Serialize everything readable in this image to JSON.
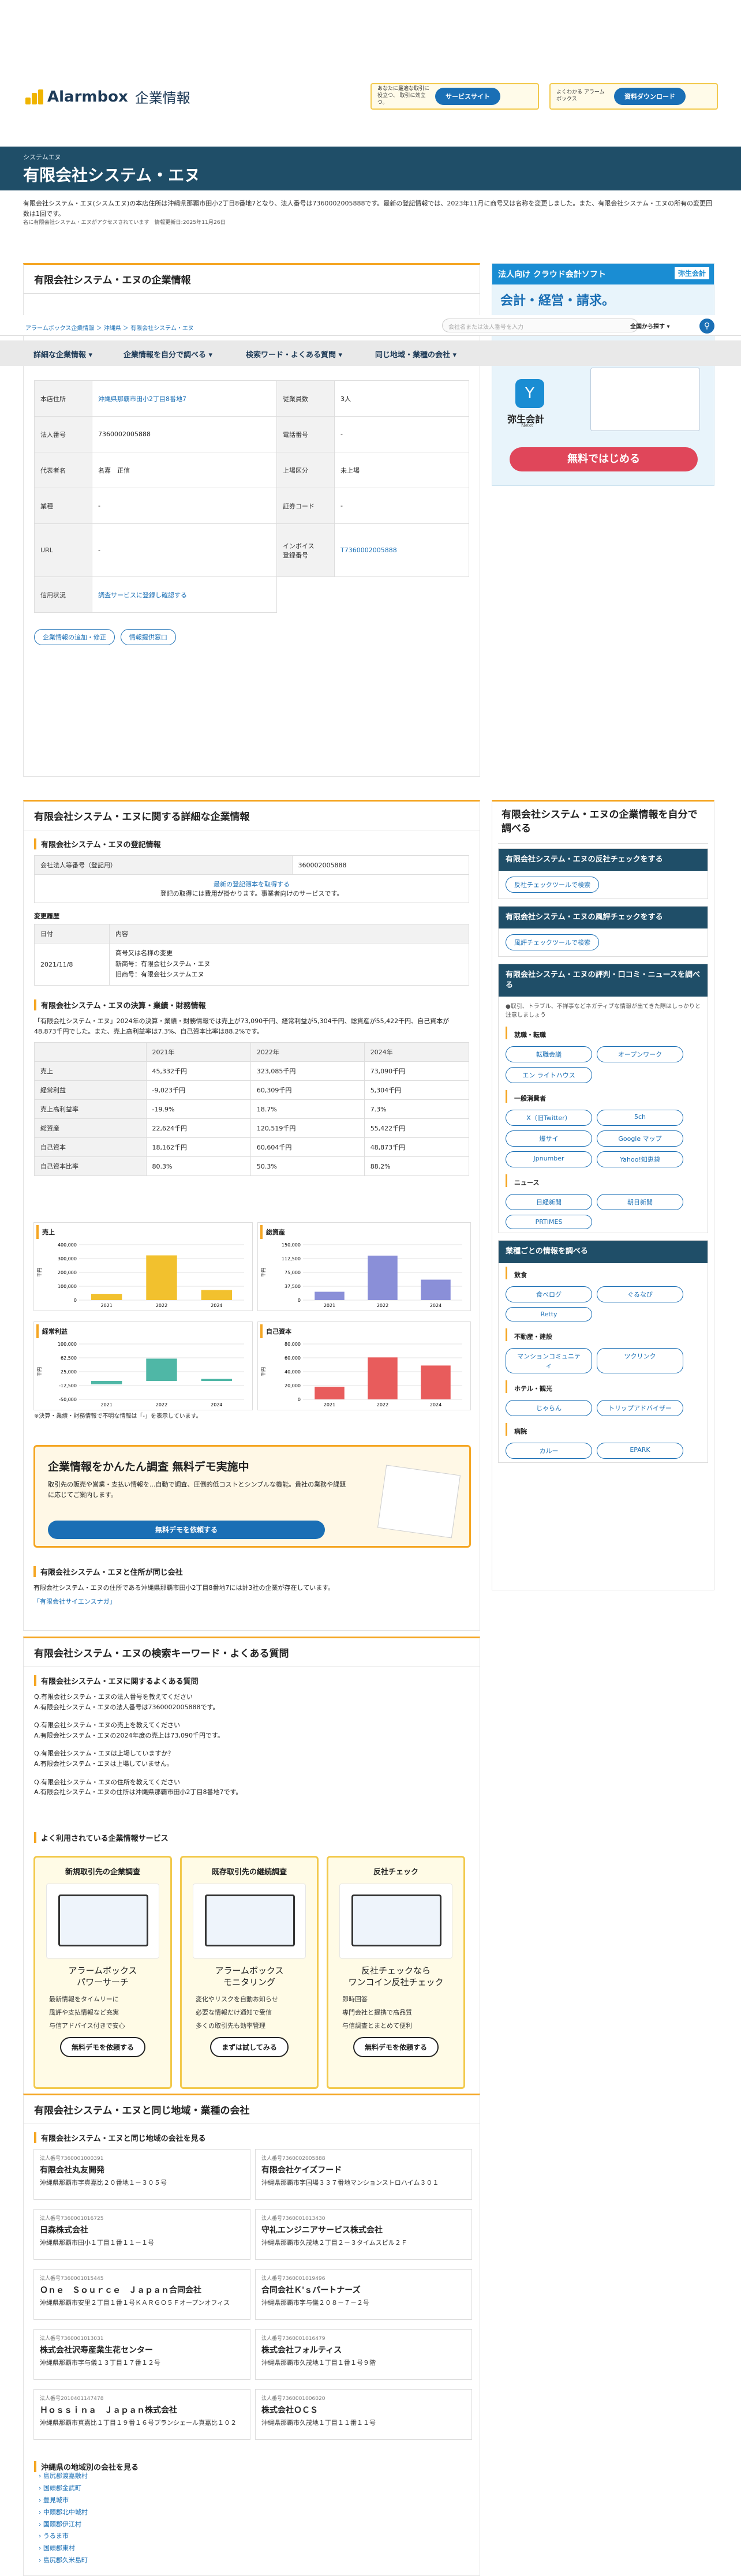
{
  "header": {
    "logo_text": "Alarmbox",
    "logo_sub": "企業情報",
    "promo1_text": "あなたに最適な取引に役立つ、\n取引に効立つ。",
    "promo1_btn": "サービスサイト",
    "promo2_text": "よくわかる\nアラームボックス",
    "promo2_btn": "資料ダウンロード"
  },
  "hero": {
    "kana": "システムエヌ",
    "title": "有限会社システム・エヌ"
  },
  "intro": {
    "text": "有限会社システム・エヌ(シスムエヌ)の本店住所は沖縄県那覇市田小2丁目8番地7となり、法人番号は7360002005888です。最新の登記情報では、2023年11月に商号又は名称を変更しました。また、有限会社システム・エヌの所有の変更回数は1回です。",
    "note": "名に有限会社システム・エヌがアクセスされています",
    "updated": "情報更新日:2025年11月26日"
  },
  "overlay": {
    "breadcrumb": "アラームボックス企業情報 ＞ 沖縄県 ＞ 有限会社システム・エヌ",
    "search_placeholder": "会社名または法人番号を入力",
    "scope": "全国から探す",
    "search_icon": "search-icon"
  },
  "nav": [
    "詳細な企業情報",
    "企業情報を自分で調べる",
    "検索ワード・よくある質問",
    "同じ地域・業種の会社"
  ],
  "company_card": {
    "title": "有限会社システム・エヌの企業情報",
    "rows": [
      {
        "k1": "本店住所",
        "v1": "沖縄県那覇市田小2丁目8番地7",
        "k2": "従業員数",
        "v2": "3人"
      },
      {
        "k1": "法人番号",
        "v1": "7360002005888",
        "k2": "電話番号",
        "v2": "-"
      },
      {
        "k1": "代表者名",
        "v1": "名嘉　正信",
        "k2": "上場区分",
        "v2": "未上場"
      },
      {
        "k1": "業種",
        "v1": "-",
        "k2": "証券コード",
        "v2": "-"
      },
      {
        "k1": "URL",
        "v1": "-",
        "k2": "インボイス\n登録番号",
        "v2": "T7360002005888"
      },
      {
        "k1": "信用状況",
        "v1": "調査サービスに登録し確認する",
        "k2": "",
        "v2": ""
      }
    ],
    "btn1": "企業情報の追加・修正",
    "btn2": "情報提供窓口"
  },
  "ad": {
    "label": "法人向け クラウド会計ソフト",
    "brand": "弥生会計",
    "headline": "会計・経営・請求。",
    "product": "弥生会計",
    "product_sub": "Next",
    "cta": "無料ではじめる"
  },
  "detail": {
    "title": "有限会社システム・エヌに関する詳細な企業情報",
    "reg_title": "有限会社システム・エヌの登記情報",
    "reg_number_label": "会社法人等番号（登記用）",
    "reg_number": "360002005888",
    "reg_link": "最新の登記簿本を取得する",
    "reg_note": "登記の取得には費用が掛かります。事業者向けのサービスです。",
    "history_label": "変更履歴",
    "h_date": "日付",
    "h_content": "内容",
    "h_row_date": "2021/11/8",
    "h_row_content": "商号又は名称の変更\n新商号：有限会社システム・エヌ\n旧商号：有限会社システムエヌ",
    "fin_title": "有限会社システム・エヌの決算・業績・財務情報",
    "fin_text": "「有限会社システム・エヌ」2024年の決算・業績・財務情報では売上が73,090千円、経常利益が5,304千円、総資産が55,422千円、自己資本が48,873千円でした。また、売上高利益率は7.3%、自己資本比率は88.2%です。",
    "fin_head": [
      "",
      "2021年",
      "2022年",
      "2024年"
    ],
    "fin_rows": [
      [
        "売上",
        "45,332千円",
        "323,085千円",
        "73,090千円"
      ],
      [
        "経常利益",
        "-9,023千円",
        "60,309千円",
        "5,304千円"
      ],
      [
        "売上高利益率",
        "-19.9%",
        "18.7%",
        "7.3%"
      ],
      [
        "総資産",
        "22,624千円",
        "120,519千円",
        "55,422千円"
      ],
      [
        "自己資本",
        "18,162千円",
        "60,604千円",
        "48,873千円"
      ],
      [
        "自己資本比率",
        "80.3%",
        "50.3%",
        "88.2%"
      ]
    ],
    "fin_note": "※決算・業績・財務情報で不明な情報は「-」を表示しています。"
  },
  "chart_data": [
    {
      "type": "bar",
      "title": "売上",
      "categories": [
        "2021",
        "2022",
        "2024"
      ],
      "values": [
        45332,
        323085,
        73090
      ],
      "ylim": [
        0,
        400000
      ],
      "ylabel": "千円",
      "color": "#f2c12e"
    },
    {
      "type": "bar",
      "title": "総資産",
      "categories": [
        "2021",
        "2022",
        "2024"
      ],
      "values": [
        22624,
        120519,
        55422
      ],
      "ylim": [
        0,
        150000
      ],
      "ylabel": "千円",
      "color": "#8a8fd8"
    },
    {
      "type": "bar",
      "title": "経常利益",
      "categories": [
        "2021",
        "2022",
        "2024"
      ],
      "values": [
        -9023,
        60309,
        5304
      ],
      "ylim": [
        -50000,
        100000
      ],
      "ylabel": "千円",
      "color": "#4fb7a6"
    },
    {
      "type": "bar",
      "title": "自己資本",
      "categories": [
        "2021",
        "2022",
        "2024"
      ],
      "values": [
        18162,
        60604,
        48873
      ],
      "ylim": [
        0,
        80000
      ],
      "ylabel": "千円",
      "color": "#e85c5c"
    }
  ],
  "demo": {
    "title": "企業情報をかんたん調査 無料デモ実施中",
    "text": "取引先の販売や営業・支払い情報を...自動で調査、圧倒的低コストとシンプルな機能。貴社の業務や課題に応じてご案内します。",
    "btn": "無料デモを依頼する"
  },
  "same_address": {
    "title": "有限会社システム・エヌと住所が同じ会社",
    "text": "有限会社システム・エヌの住所である沖縄県那覇市田小2丁目8番地7には計3社の企業が存在しています。",
    "link": "「有限会社サイエンスナガ」"
  },
  "side": {
    "title": "有限会社システム・エヌの企業情報を自分で調べる",
    "b1": "有限会社システム・エヌの反社チェックをする",
    "b1btn": "反社チェックツールで検索",
    "b2": "有限会社システム・エヌの風評チェックをする",
    "b2btn": "風評チェックツールで検索",
    "b3": "有限会社システム・エヌの評判・口コミ・ニュースを調べる",
    "b3note": "●取引、トラブル、不祥事などネガティブな情報が出てきた際はしっかりと注意しましょう",
    "cat1": "就職・転職",
    "cat1_items": [
      "転職会議",
      "オープンワーク",
      "エン ライトハウス"
    ],
    "cat2": "一般消費者",
    "cat2_items": [
      "X（旧Twitter）",
      "5ch",
      "爆サイ",
      "Google マップ",
      "Jpnumber",
      "Yahoo!知恵袋"
    ],
    "cat3": "ニュース",
    "cat3_items": [
      "日経新聞",
      "朝日新聞",
      "PRTIMES"
    ],
    "b4": "業種ごとの情報を調べる",
    "cat4": "飲食",
    "cat4_items": [
      "食べログ",
      "ぐるなび",
      "Retty"
    ],
    "cat5": "不動産・建設",
    "cat5_items": [
      "マンションコミュニティ",
      "ツクリンク"
    ],
    "cat6": "ホテル・観光",
    "cat6_items": [
      "じゃらん",
      "トリップアドバイザー"
    ],
    "cat7": "病院",
    "cat7_items": [
      "カルー",
      "EPARK"
    ]
  },
  "faq": {
    "title": "有限会社システム・エヌの検索キーワード・よくある質問",
    "sub": "有限会社システム・エヌに関するよくある質問",
    "items": [
      {
        "q": "Q.有限会社システム・エヌの法人番号を教えてください",
        "a": "A.有限会社システム・エヌの法人番号は7360002005888です。"
      },
      {
        "q": "Q.有限会社システム・エヌの売上を教えてください",
        "a": "A.有限会社システム・エヌの2024年度の売上は73,090千円です。"
      },
      {
        "q": "Q.有限会社システム・エヌは上場していますか？",
        "a": "A.有限会社システム・エヌは上場していません。"
      },
      {
        "q": "Q.有限会社システム・エヌの住所を教えてください",
        "a": "A.有限会社システム・エヌの住所は沖縄県那覇市田小2丁目8番地7です。"
      }
    ],
    "svc_title": "よく利用されている企業情報サービス",
    "svcs": [
      {
        "h": "新規取引先の企業調査",
        "n": "アラームボックス\nパワーサーチ",
        "l": [
          "最新情報をタイムリーに",
          "風評や支払情報など充実",
          "与信アドバイス付きで安心"
        ],
        "b": "無料デモを依頼する"
      },
      {
        "h": "既存取引先の継続調査",
        "n": "アラームボックス\nモニタリング",
        "l": [
          "変化やリスクを自動お知らせ",
          "必要な情報だけ通知で受信",
          "多くの取引先も効率管理"
        ],
        "b": "まずは試してみる"
      },
      {
        "h": "反社チェック",
        "n": "反社チェックなら\nワンコイン反社チェック",
        "l": [
          "即時回答",
          "専門会社と提携で高品質",
          "与信調査とまとめて便利"
        ],
        "b": "無料デモを依頼する"
      }
    ]
  },
  "region": {
    "title": "有限会社システム・エヌと同じ地域・業種の会社",
    "sub": "有限会社システム・エヌと同じ地域の会社を見る",
    "companies": [
      {
        "num": "法人番号7360001000391",
        "name": "有限会社丸友開発",
        "addr": "沖縄県那覇市字真嘉比２０番地１－３０５号"
      },
      {
        "num": "法人番号7360002005888",
        "name": "有限会社ケイズフード",
        "addr": "沖縄県那覇市字国場３３７番地マンションストロハイム３０１"
      },
      {
        "num": "法人番号7360001016725",
        "name": "日森株式会社",
        "addr": "沖縄県那覇市田小１丁目１番１１－１号"
      },
      {
        "num": "法人番号7360001013430",
        "name": "守礼エンジニアサービス株式会社",
        "addr": "沖縄県那覇市久茂地２丁目２－３タイムスビル２Ｆ"
      },
      {
        "num": "法人番号7360001015445",
        "name": "Ｏｎｅ　Ｓｏｕｒｃｅ　Ｊａｐａｎ合同会社",
        "addr": "沖縄県那覇市安里２丁目１番１号ＫＡＲＧＯ５Ｆオープンオフィス",
        "addr2": ""
      },
      {
        "num": "法人番号7360001019496",
        "name": "合同会社Ｋ'ｓパートナーズ",
        "addr": "沖縄県那覇市字与儀２０８－７－２号"
      },
      {
        "num": "法人番号7360001013031",
        "name": "株式会社沢寿産業生花センター",
        "addr": "沖縄県那覇市字与儀１３丁目１７番１２号"
      },
      {
        "num": "法人番号7360001016479",
        "name": "株式会社フォルティス",
        "addr": "沖縄県那覇市久茂地１丁目１番１号９階"
      },
      {
        "num": "法人番号2010401147478",
        "name": "Ｈｏｓｓｉｎａ　Ｊａｐａｎ株式会社",
        "addr": "沖縄県那覇市真嘉比１丁目１９番１６号プランシェール真嘉比１０２"
      },
      {
        "num": "法人番号7360001006020",
        "name": "株式会社ＯＣＳ",
        "addr": "沖縄県那覇市久茂地１丁目１１番１１号"
      }
    ],
    "area_title": "沖縄県の地域別の会社を見る",
    "areas": [
      "島尻郡渡嘉敷村",
      "国頭郡金武町",
      "豊見城市",
      "中頭郡北中城村",
      "国頭郡伊江村",
      "うるま市",
      "国頭郡東村",
      "島尻郡久米島町"
    ]
  }
}
